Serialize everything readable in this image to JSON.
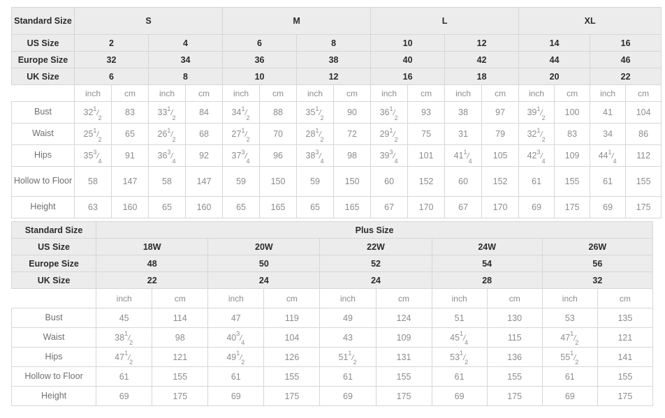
{
  "standard_table": {
    "label_column_header": "Standard Size",
    "size_groups": [
      "S",
      "M",
      "L",
      "XL"
    ],
    "row_headers": [
      "US Size",
      "Europe Size",
      "UK Size"
    ],
    "us_size": [
      "2",
      "4",
      "6",
      "8",
      "10",
      "12",
      "14",
      "16"
    ],
    "europe_size": [
      "32",
      "34",
      "36",
      "38",
      "40",
      "42",
      "44",
      "46"
    ],
    "uk_size": [
      "6",
      "8",
      "10",
      "12",
      "16",
      "18",
      "20",
      "22"
    ],
    "units": [
      "inch",
      "cm",
      "inch",
      "cm",
      "inch",
      "cm",
      "inch",
      "cm",
      "inch",
      "cm",
      "inch",
      "cm",
      "inch",
      "cm",
      "inch",
      "cm"
    ],
    "unit_inch": "inch",
    "unit_cm": "cm",
    "measurements": [
      {
        "name": "Bust",
        "inch": [
          "32 1/2",
          "33 1/2",
          "34 1/2",
          "35 1/2",
          "36 1/2",
          "38",
          "39 1/2",
          "41"
        ],
        "cm": [
          "83",
          "84",
          "88",
          "90",
          "93",
          "97",
          "100",
          "104"
        ]
      },
      {
        "name": "Waist",
        "inch": [
          "25 1/2",
          "26 1/2",
          "27 1/2",
          "28 1/2",
          "29 1/2",
          "31",
          "32 1/2",
          "34"
        ],
        "cm": [
          "65",
          "68",
          "70",
          "72",
          "75",
          "79",
          "83",
          "86"
        ]
      },
      {
        "name": "Hips",
        "inch": [
          "35 3/4",
          "36 3/4",
          "37 3/4",
          "38 3/4",
          "39 3/4",
          "41 1/4",
          "42 3/4",
          "44 1/4"
        ],
        "cm": [
          "91",
          "92",
          "96",
          "98",
          "101",
          "105",
          "109",
          "112"
        ]
      },
      {
        "name": "Hollow to Floor",
        "inch": [
          "58",
          "58",
          "59",
          "59",
          "60",
          "60",
          "61",
          "61"
        ],
        "cm": [
          "147",
          "147",
          "150",
          "150",
          "152",
          "152",
          "155",
          "155"
        ]
      },
      {
        "name": "Height",
        "inch": [
          "63",
          "65",
          "65",
          "65",
          "67",
          "67",
          "69",
          "69"
        ],
        "cm": [
          "160",
          "160",
          "165",
          "165",
          "170",
          "170",
          "175",
          "175"
        ]
      }
    ]
  },
  "plus_table": {
    "label_column_header": "Standard Size",
    "group_title": "Plus Size",
    "row_headers": [
      "US Size",
      "Europe Size",
      "UK Size"
    ],
    "us_size": [
      "18W",
      "20W",
      "22W",
      "24W",
      "26W"
    ],
    "europe_size": [
      "48",
      "50",
      "52",
      "54",
      "56"
    ],
    "uk_size": [
      "22",
      "24",
      "24",
      "28",
      "32"
    ],
    "unit_inch": "inch",
    "unit_cm": "cm",
    "measurements": [
      {
        "name": "Bust",
        "inch": [
          "45",
          "47",
          "49",
          "51",
          "53"
        ],
        "cm": [
          "114",
          "119",
          "124",
          "130",
          "135"
        ]
      },
      {
        "name": "Waist",
        "inch": [
          "38 1/2",
          "40 3/4",
          "43",
          "45 1/4",
          "47 1/2"
        ],
        "cm": [
          "98",
          "104",
          "109",
          "115",
          "121"
        ]
      },
      {
        "name": "Hips",
        "inch": [
          "47 1/2",
          "49 1/2",
          "51 1/2",
          "53 1/2",
          "55 1/2"
        ],
        "cm": [
          "121",
          "126",
          "131",
          "136",
          "141"
        ]
      },
      {
        "name": "Hollow to Floor",
        "inch": [
          "61",
          "61",
          "61",
          "61",
          "61"
        ],
        "cm": [
          "155",
          "155",
          "155",
          "155",
          "155"
        ]
      },
      {
        "name": "Height",
        "inch": [
          "69",
          "69",
          "69",
          "69",
          "69"
        ],
        "cm": [
          "175",
          "175",
          "175",
          "175",
          "175"
        ]
      }
    ]
  },
  "colors": {
    "header_bg": "#ececec",
    "border": "#d6d6d6",
    "header_text": "#2b2b2b",
    "body_text": "#8c8c8c",
    "label_text": "#6f6f6f",
    "page_bg": "#ffffff"
  }
}
